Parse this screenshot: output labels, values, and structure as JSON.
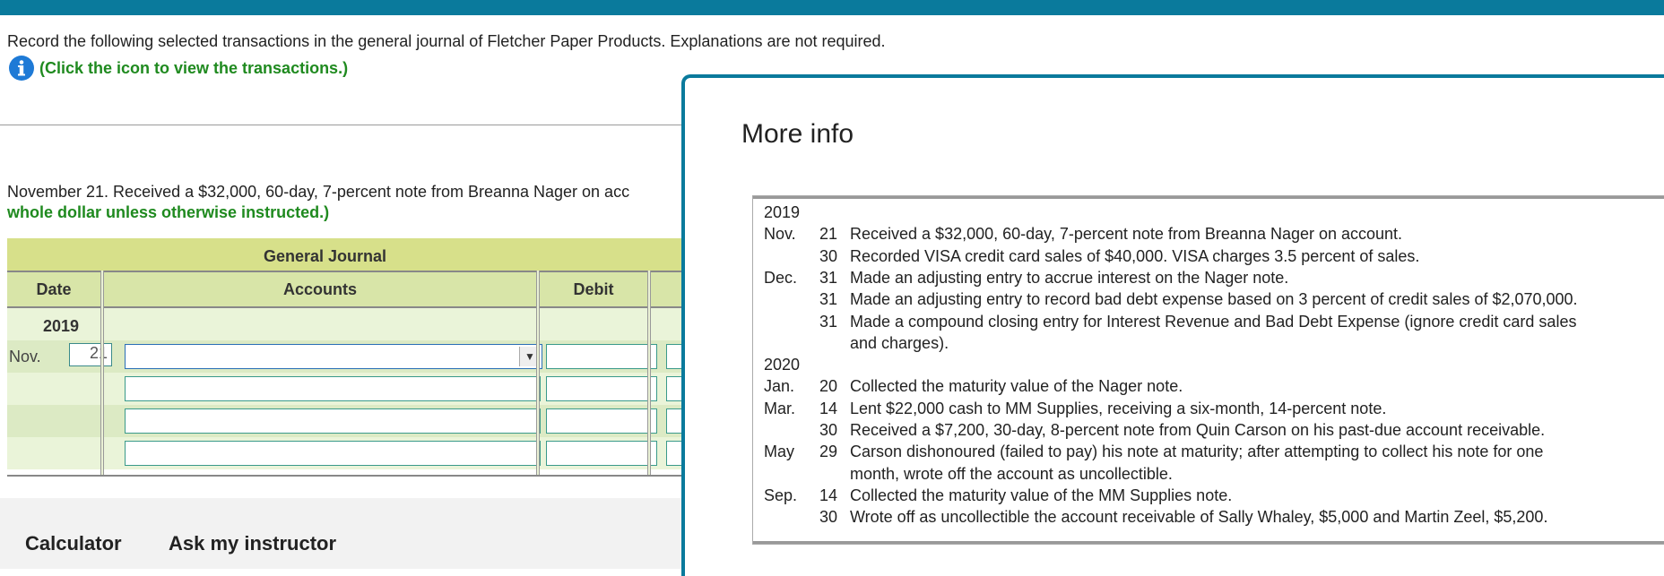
{
  "instructions": "Record the following selected transactions in the general journal of Fletcher Paper Products. Explanations are not required.",
  "info_link": "(Click the icon to view the transactions.)",
  "question_text": "November 21. Received a $32,000, 60-day, 7-percent note from Breanna Nager on acc",
  "question_bold": "whole dollar unless otherwise instructed.)",
  "journal": {
    "title": "General Journal",
    "headers": {
      "date": "Date",
      "accounts": "Accounts",
      "debit": "Debit"
    },
    "year": "2019",
    "month": "Nov.",
    "day": "21"
  },
  "footer": {
    "calculator": "Calculator",
    "ask": "Ask my instructor"
  },
  "modal": {
    "title": "More info",
    "rows": [
      {
        "month": "2019",
        "day": "",
        "desc": ""
      },
      {
        "month": "Nov.",
        "day": "21",
        "desc": "Received a $32,000, 60-day, 7-percent note from Breanna Nager on account."
      },
      {
        "month": "",
        "day": "30",
        "desc": "Recorded VISA credit card sales of $40,000. VISA charges 3.5 percent of sales."
      },
      {
        "month": "Dec.",
        "day": "31",
        "desc": "Made an adjusting entry to accrue interest on the Nager note."
      },
      {
        "month": "",
        "day": "31",
        "desc": "Made an adjusting entry to record bad debt expense based on 3 percent of credit sales of $2,070,000."
      },
      {
        "month": "",
        "day": "31",
        "desc": "Made a compound closing entry for Interest Revenue and Bad Debt Expense (ignore credit card sales"
      },
      {
        "month": "",
        "day": "",
        "desc": "and charges)."
      },
      {
        "month": "2020",
        "day": "",
        "desc": ""
      },
      {
        "month": "Jan.",
        "day": "20",
        "desc": "Collected the maturity value of the Nager note."
      },
      {
        "month": "Mar.",
        "day": "14",
        "desc": "Lent $22,000 cash to MM Supplies, receiving a six-month, 14-percent note."
      },
      {
        "month": "",
        "day": "30",
        "desc": "Received a $7,200, 30-day, 8-percent note from Quin Carson on his past-due account receivable."
      },
      {
        "month": "May",
        "day": "29",
        "desc": "Carson dishonoured (failed to pay) his note at maturity; after attempting to collect his note for one"
      },
      {
        "month": "",
        "day": "",
        "desc": "month, wrote off the account as uncollectible."
      },
      {
        "month": "Sep.",
        "day": "14",
        "desc": "Collected the maturity value of the MM Supplies note."
      },
      {
        "month": "",
        "day": "30",
        "desc": "Wrote off as uncollectible the account receivable of Sally Whaley, $5,000 and Martin Zeel, $5,200."
      }
    ]
  }
}
